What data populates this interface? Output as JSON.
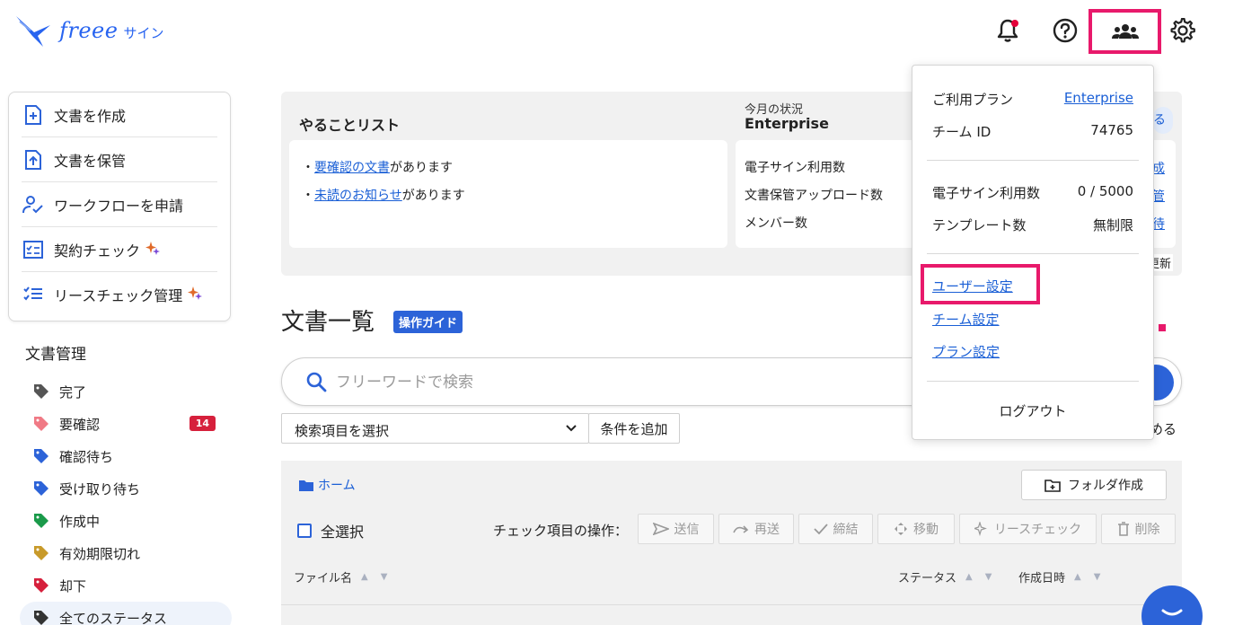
{
  "header": {
    "logo_word": "freee",
    "logo_suffix": "サイン"
  },
  "sidebar": {
    "actions": [
      {
        "label": "文書を作成"
      },
      {
        "label": "文書を保管"
      },
      {
        "label": "ワークフローを申請"
      },
      {
        "label": "契約チェック"
      },
      {
        "label": "リースチェック管理"
      }
    ],
    "section_title": "文書管理",
    "statuses": [
      {
        "label": "完了",
        "color": "#555555"
      },
      {
        "label": "要確認",
        "color": "#f07a85",
        "badge": "14"
      },
      {
        "label": "確認待ち",
        "color": "#2c63d8"
      },
      {
        "label": "受け取り待ち",
        "color": "#2c63d8"
      },
      {
        "label": "作成中",
        "color": "#1a9a4a"
      },
      {
        "label": "有効期限切れ",
        "color": "#c89a2a"
      },
      {
        "label": "却下",
        "color": "#d6203c"
      },
      {
        "label": "全てのステータス",
        "color": "#333333"
      }
    ]
  },
  "todo": {
    "title": "やることリスト",
    "item1_link": "要確認の文書",
    "item1_suffix": "があります",
    "item2_link": "未読のお知らせ",
    "item2_suffix": "があります",
    "bullet": "・"
  },
  "month_status": {
    "label": "今月の状況",
    "plan": "Enterprise",
    "rows": [
      "電子サイン利用数",
      "文書保管アップロード数",
      "メンバー数"
    ],
    "peek": [
      "る",
      "成",
      "管",
      "待",
      "更新"
    ]
  },
  "documents": {
    "title": "文書一覧",
    "guide_badge": "操作ガイド",
    "search_placeholder": "フリーワードで検索",
    "select_field": "検索項目を選択",
    "add_condition": "条件を追加",
    "collapse": "める",
    "breadcrumb_home": "ホーム",
    "create_folder": "フォルダ作成",
    "select_all": "全選択",
    "ops_label": "チェック項目の操作：",
    "ops": {
      "send": "送信",
      "resend": "再送",
      "conclude": "締結",
      "move": "移動",
      "lease_check": "リースチェック",
      "delete": "削除"
    },
    "columns": {
      "filename": "ファイル名",
      "status": "ステータス",
      "created": "作成日時"
    }
  },
  "dropdown": {
    "plan_label": "ご利用プラン",
    "plan_value": "Enterprise",
    "team_id_label": "チーム ID",
    "team_id_value": "74765",
    "esign_label": "電子サイン利用数",
    "esign_value": "0 / 5000",
    "template_label": "テンプレート数",
    "template_value": "無制限",
    "user_settings": "ユーザー設定",
    "team_settings": "チーム設定",
    "plan_settings": "プラン設定",
    "logout": "ログアウト"
  },
  "colors": {
    "accent": "#2c63d8",
    "highlight": "#e8196b",
    "notification": "#e4003a"
  }
}
